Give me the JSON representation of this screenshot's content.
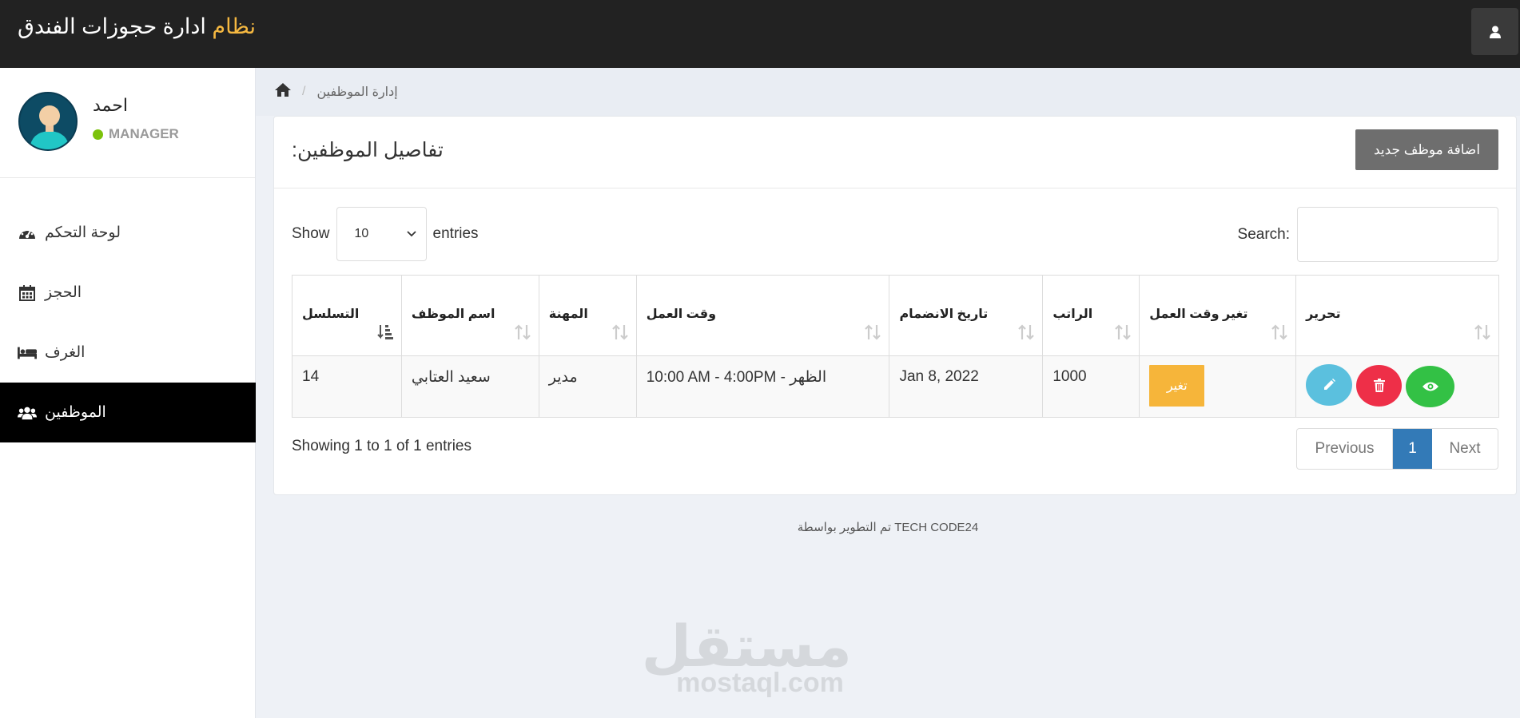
{
  "header": {
    "title_accent": "نظام",
    "title_rest": "ادارة حجوزات الفندق",
    "user_icon": "user-icon"
  },
  "sidebar": {
    "profile": {
      "name": "احمد",
      "role": "MANAGER",
      "status_color": "#7cc20b"
    },
    "items": [
      {
        "label": "لوحة التحكم",
        "icon": "dashboard-icon"
      },
      {
        "label": "الحجز",
        "icon": "calendar-icon"
      },
      {
        "label": "الغرف",
        "icon": "bed-icon"
      },
      {
        "label": "الموظفين",
        "icon": "users-icon",
        "active": true
      }
    ]
  },
  "breadcrumb": {
    "home_icon": "home-icon",
    "current": "إدارة الموظفين"
  },
  "panel": {
    "title": "تفاصيل الموظفين:",
    "add_button": "اضافة موظف جديد"
  },
  "table_controls": {
    "show_label": "Show",
    "page_size": "10",
    "entries_label": "entries",
    "search_label": "Search:",
    "search_value": ""
  },
  "table": {
    "columns": [
      "التسلسل",
      "اسم الموظف",
      "المهنة",
      "وقت العمل",
      "تاريخ الانضمام",
      "الراتب",
      "تغير وقت العمل",
      "تحرير"
    ],
    "rows": [
      {
        "id": "14",
        "name": "سعيد العتابي",
        "job": "مدير",
        "shift": "10:00 AM - 4:00PM - الظهر",
        "joined": "Jan 8, 2022",
        "salary": "1000",
        "change_label": "تغير"
      }
    ]
  },
  "pagination": {
    "info": "Showing 1 to 1 of 1 entries",
    "previous": "Previous",
    "current": "1",
    "next": "Next"
  },
  "footer": {
    "text": "تم التطوير بواسطة TECH CODE24"
  },
  "watermark": {
    "arabic": "مستقل",
    "latin": "mostaql.com"
  },
  "colors": {
    "topbar": "#222222",
    "accent": "#f5b841",
    "active_nav": "#000000",
    "primary": "#337ab7",
    "edit": "#5bc0de",
    "delete": "#ee2f48",
    "view": "#33c145",
    "warning": "#f6b53a"
  }
}
